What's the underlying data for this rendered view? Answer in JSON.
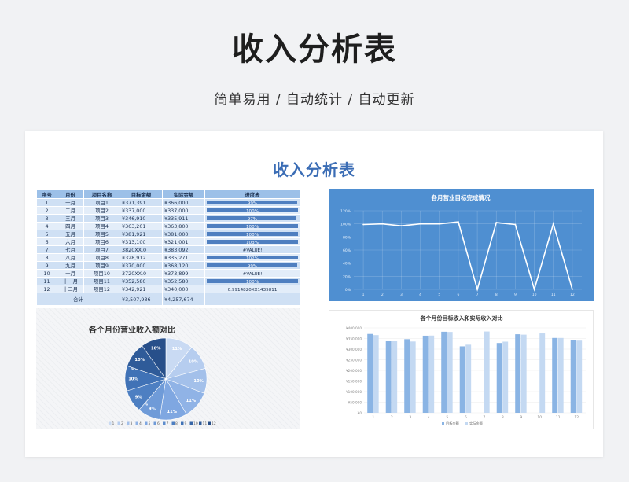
{
  "hero": {
    "title": "收入分析表",
    "subtitle": "简单易用 / 自动统计 / 自动更新"
  },
  "sheet": {
    "title": "收入分析表"
  },
  "table": {
    "headers": [
      "序号",
      "月份",
      "项目名称",
      "目标金额",
      "实际金额",
      "进度表"
    ],
    "rows": [
      {
        "no": "1",
        "month": "一月",
        "project": "项目1",
        "target": "¥371,391",
        "actual": "¥366,000",
        "progress": "99%",
        "pct": 99
      },
      {
        "no": "2",
        "month": "二月",
        "project": "项目2",
        "target": "¥337,000",
        "actual": "¥337,000",
        "progress": "100%",
        "pct": 100
      },
      {
        "no": "3",
        "month": "三月",
        "project": "项目3",
        "target": "¥346,910",
        "actual": "¥335,911",
        "progress": "97%",
        "pct": 97
      },
      {
        "no": "4",
        "month": "四月",
        "project": "项目4",
        "target": "¥363,201",
        "actual": "¥363,800",
        "progress": "100%",
        "pct": 100
      },
      {
        "no": "5",
        "month": "五月",
        "project": "项目5",
        "target": "¥381,921",
        "actual": "¥381,000",
        "progress": "100%",
        "pct": 100
      },
      {
        "no": "6",
        "month": "六月",
        "project": "项目6",
        "target": "¥313,100",
        "actual": "¥321,001",
        "progress": "103%",
        "pct": 100
      },
      {
        "no": "7",
        "month": "七月",
        "project": "项目7",
        "target": "3820XX.0",
        "actual": "¥383,092",
        "progress": "#VALUE!",
        "pct": 0
      },
      {
        "no": "8",
        "month": "八月",
        "project": "项目8",
        "target": "¥328,912",
        "actual": "¥335,271",
        "progress": "102%",
        "pct": 100
      },
      {
        "no": "9",
        "month": "九月",
        "project": "项目9",
        "target": "¥370,000",
        "actual": "¥368,120",
        "progress": "99%",
        "pct": 99
      },
      {
        "no": "10",
        "month": "十月",
        "project": "项目10",
        "target": "3720XX.0",
        "actual": "¥373,899",
        "progress": "#VALUE!",
        "pct": 0
      },
      {
        "no": "11",
        "month": "十一月",
        "project": "项目11",
        "target": "¥352,580",
        "actual": "¥352,580",
        "progress": "100%",
        "pct": 100
      },
      {
        "no": "12",
        "month": "十二月",
        "project": "项目12",
        "target": "¥342,921",
        "actual": "¥340,000",
        "progress": "0.9914820XX1435811",
        "pct": 0
      }
    ],
    "total": {
      "label": "合计",
      "target": "¥3,507,936",
      "actual": "¥4,257,674"
    }
  },
  "chart_data": [
    {
      "type": "line",
      "title": "各月营业目标完成情况",
      "x": [
        "1",
        "2",
        "3",
        "4",
        "5",
        "6",
        "7",
        "8",
        "9",
        "10",
        "11",
        "12"
      ],
      "values": [
        99,
        100,
        97,
        100,
        100,
        103,
        0,
        102,
        99,
        0,
        100,
        0
      ],
      "ylim": [
        0,
        120
      ],
      "yticks": [
        "0%",
        "20%",
        "40%",
        "60%",
        "80%",
        "100%",
        "120%"
      ],
      "colors": {
        "background": "#4f8fd1",
        "line": "#ffffff"
      }
    },
    {
      "type": "bar",
      "title": "各个月份目标收入和实际收入对比",
      "categories": [
        "1",
        "2",
        "3",
        "4",
        "5",
        "6",
        "7",
        "8",
        "9",
        "10",
        "11",
        "12"
      ],
      "series": [
        {
          "name": "目标金额",
          "values": [
            371391,
            337000,
            346910,
            363201,
            381921,
            313100,
            0,
            328912,
            370000,
            0,
            352580,
            342921
          ]
        },
        {
          "name": "实际金额",
          "values": [
            366000,
            337000,
            335911,
            363800,
            381000,
            321001,
            383092,
            335271,
            368120,
            373899,
            352580,
            340000
          ]
        }
      ],
      "ylim": [
        0,
        400000
      ],
      "yticks": [
        "¥0",
        "¥50,000",
        "¥100,000",
        "¥150,000",
        "¥200,000",
        "¥250,000",
        "¥300,000",
        "¥350,000",
        "¥400,000"
      ],
      "legend": "bottom",
      "colors": {
        "target": "#8ab4e4",
        "actual": "#c4d9f2"
      }
    },
    {
      "type": "pie",
      "title": "各个月份营业收入额对比",
      "labels": [
        "1",
        "2",
        "3",
        "4",
        "5",
        "6",
        "7",
        "8",
        "9",
        "10",
        "11",
        "12"
      ],
      "values": [
        11,
        10,
        10,
        11,
        11,
        9,
        0,
        9,
        10,
        0,
        10,
        10
      ],
      "slice_labels": [
        "11%",
        "10%",
        "10%",
        "11%",
        "11%",
        "9%",
        "0%",
        "9%",
        "10%",
        "0%",
        "10%",
        "10%"
      ],
      "legend": "bottom",
      "colors": [
        "#c9daf3",
        "#b6cdef",
        "#a3c0ea",
        "#90b3e6",
        "#7fa7e1",
        "#6f9bd8",
        "#5d8dcd",
        "#4d7fc2",
        "#4072b6",
        "#3766a8",
        "#2f5b99",
        "#274f8a"
      ]
    }
  ]
}
